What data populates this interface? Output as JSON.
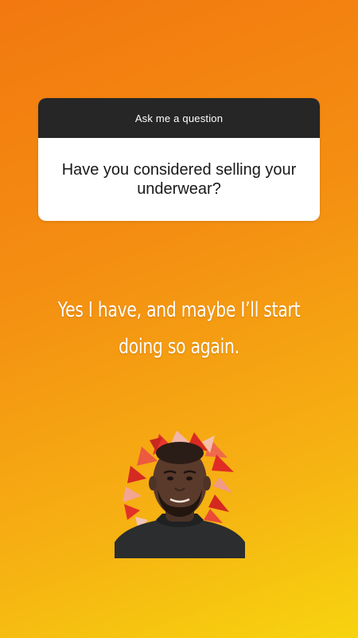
{
  "question_sticker": {
    "header": "Ask me a question",
    "question": "Have you considered selling your underwear?"
  },
  "answer": {
    "text": "Yes I have, and maybe I’ll start doing so again."
  },
  "sticker": {
    "icon": "person-cutout-sticker-icon"
  },
  "colors": {
    "gradient_start": "#f2780f",
    "gradient_end": "#f7d40f",
    "card_header": "#262626",
    "card_body": "#ffffff",
    "answer_text": "#ffffff"
  }
}
